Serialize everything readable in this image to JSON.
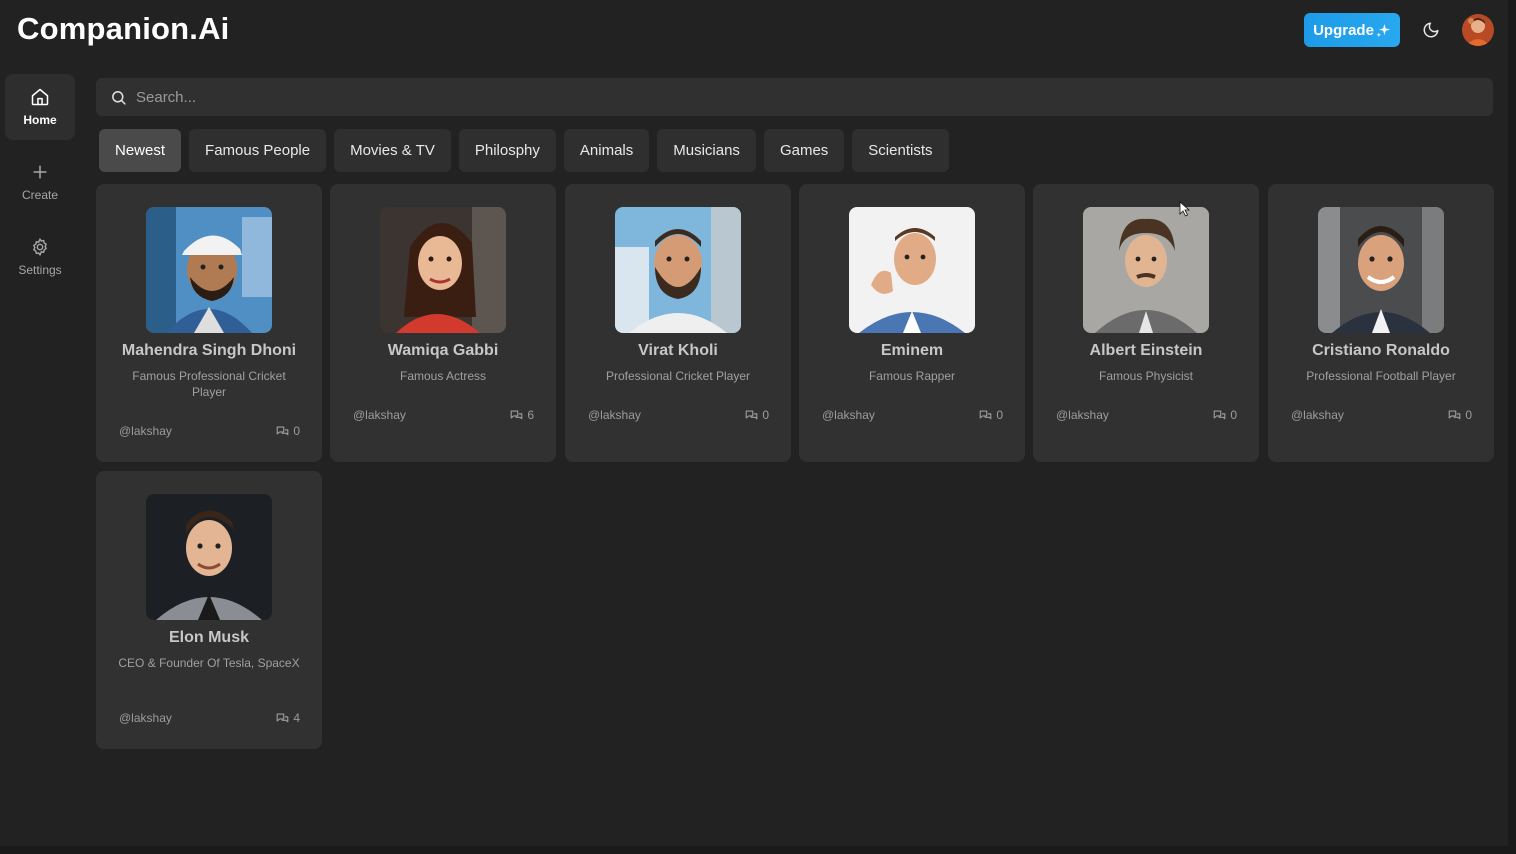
{
  "app": {
    "title": "Companion.Ai"
  },
  "header": {
    "upgrade_label": "Upgrade"
  },
  "sidebar": {
    "items": [
      {
        "label": "Home",
        "icon": "home-icon",
        "active": true
      },
      {
        "label": "Create",
        "icon": "plus-icon",
        "active": false
      },
      {
        "label": "Settings",
        "icon": "gear-icon",
        "active": false
      }
    ]
  },
  "search": {
    "placeholder": "Search..."
  },
  "categories": [
    "Newest",
    "Famous People",
    "Movies & TV",
    "Philosphy",
    "Animals",
    "Musicians",
    "Games",
    "Scientists"
  ],
  "selected_category": "Newest",
  "companions": [
    {
      "name": "Mahendra Singh Dhoni",
      "description": "Famous Professional Cricket Player",
      "author": "@lakshay",
      "messages": "0"
    },
    {
      "name": "Wamiqa Gabbi",
      "description": "Famous Actress",
      "author": "@lakshay",
      "messages": "6"
    },
    {
      "name": "Virat Kholi",
      "description": "Professional Cricket Player",
      "author": "@lakshay",
      "messages": "0"
    },
    {
      "name": "Eminem",
      "description": "Famous Rapper",
      "author": "@lakshay",
      "messages": "0"
    },
    {
      "name": "Albert Einstein",
      "description": "Famous Physicist",
      "author": "@lakshay",
      "messages": "0"
    },
    {
      "name": "Cristiano Ronaldo",
      "description": "Professional Football Player",
      "author": "@lakshay",
      "messages": "0"
    },
    {
      "name": "Elon Musk",
      "description": "CEO & Founder Of Tesla, SpaceX",
      "author": "@lakshay",
      "messages": "4"
    }
  ],
  "colors": {
    "background": "#222222",
    "card": "#313131",
    "accent": "#1e9be8"
  }
}
